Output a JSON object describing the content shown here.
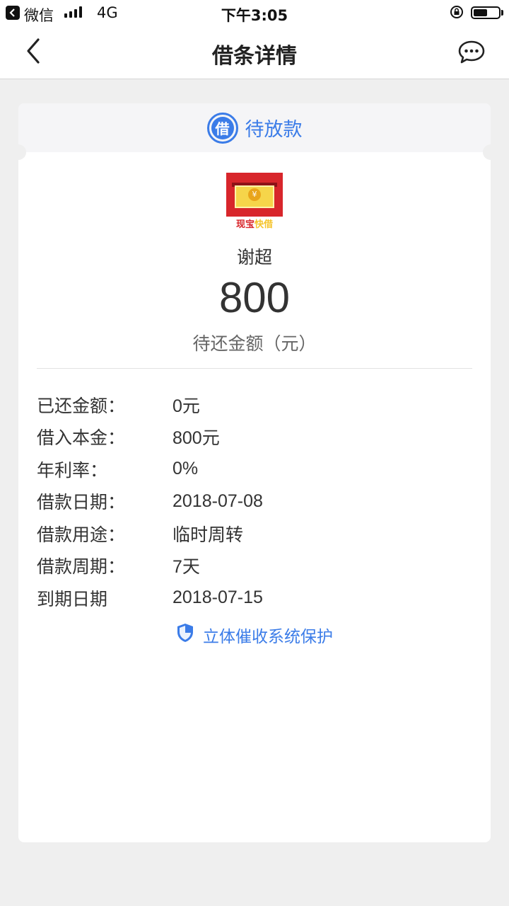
{
  "status_bar": {
    "app_name": "微信",
    "network": "4G",
    "time": "下午3:05",
    "battery_percent": 55
  },
  "nav": {
    "title": "借条详情",
    "back_icon": "chevron-left-icon",
    "chat_icon": "chat-bubble-icon"
  },
  "card": {
    "status_icon_char": "借",
    "status": "待放款",
    "logo": {
      "coin": "¥",
      "text_part1": "现宝",
      "text_part2": "快借"
    },
    "borrower": "谢超",
    "amount": "800",
    "amount_label": "待还金额（元）",
    "details": [
      {
        "label": "已还金额：",
        "value": "0元"
      },
      {
        "label": "借入本金：",
        "value": "800元"
      },
      {
        "label": "年利率：",
        "value": "0%"
      },
      {
        "label": "借款日期：",
        "value": "2018-07-08"
      },
      {
        "label": "借款用途：",
        "value": "临时周转"
      },
      {
        "label": "借款周期：",
        "value": "7天"
      },
      {
        "label": "到期日期",
        "value": "2018-07-15"
      }
    ],
    "protection": "立体催收系统保护"
  },
  "colors": {
    "accent": "#3b7ce8",
    "background": "#efefef",
    "logo_red": "#d8262b"
  }
}
